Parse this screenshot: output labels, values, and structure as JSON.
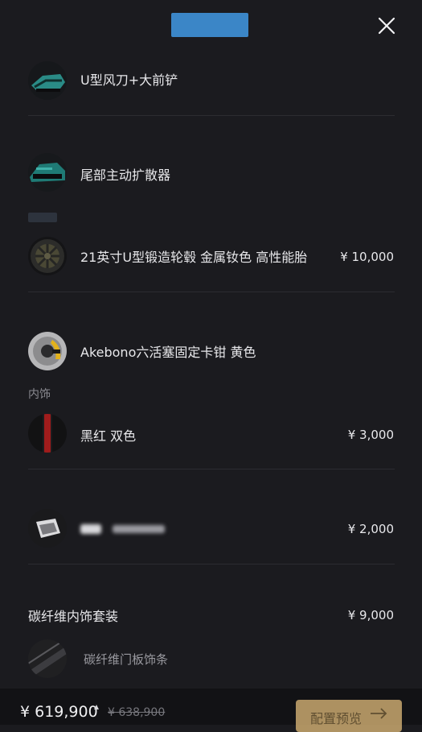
{
  "header": {
    "close_icon": "close-icon"
  },
  "items": [
    {
      "label": "U型风刀+大前铲",
      "price": ""
    },
    {
      "label": "尾部主动扩散器",
      "price": ""
    },
    {
      "label": "21英寸U型锻造轮毂 金属钕色 高性能胎",
      "price": "¥ 10,000"
    },
    {
      "label": "Akebono六活塞固定卡钳 黄色",
      "price": ""
    }
  ],
  "interior": {
    "section_title": "内饰",
    "color_option": {
      "label": "黑红 双色",
      "price": "¥ 3,000"
    },
    "redacted_option": {
      "price": "¥ 2,000"
    },
    "carbon_package": {
      "label": "碳纤维内饰套装",
      "price": "¥ 9,000"
    },
    "carbon_sub": {
      "label": "碳纤维门板饰条"
    }
  },
  "footer": {
    "total": "¥ 619,900",
    "original": "¥ 638,900",
    "cta_label": "配置预览"
  }
}
